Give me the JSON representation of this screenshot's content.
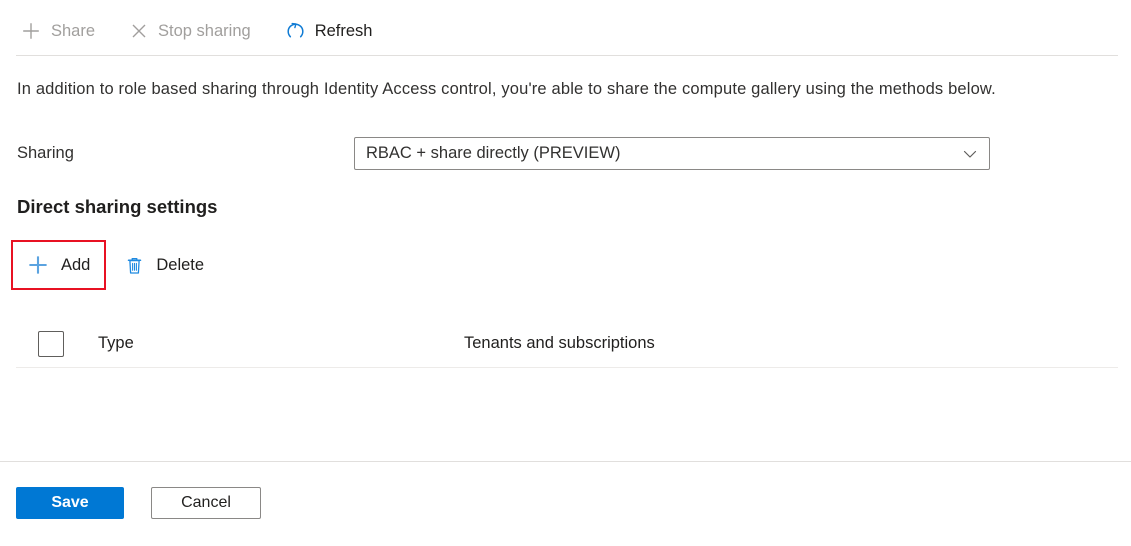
{
  "toolbar": {
    "items": [
      {
        "label": "Share",
        "icon": "plus-icon",
        "enabled": false
      },
      {
        "label": "Stop sharing",
        "icon": "close-x-icon",
        "enabled": false
      },
      {
        "label": "Refresh",
        "icon": "refresh-icon",
        "enabled": true
      }
    ]
  },
  "description": "In addition to role based sharing through Identity Access control, you're able to share the compute gallery using the methods below.",
  "sharing": {
    "label": "Sharing",
    "selected": "RBAC + share directly (PREVIEW)",
    "chevron": "chevron-down-icon"
  },
  "direct_sharing": {
    "heading": "Direct sharing settings",
    "commands": [
      {
        "label": "Add",
        "icon": "plus-icon",
        "highlighted": true
      },
      {
        "label": "Delete",
        "icon": "trash-icon",
        "highlighted": false
      }
    ],
    "table": {
      "select_all_checked": false,
      "columns": [
        "Type",
        "Tenants and subscriptions"
      ],
      "rows": []
    }
  },
  "footer": {
    "save_label": "Save",
    "cancel_label": "Cancel"
  },
  "colors": {
    "accent_blue": "#0078d4",
    "icon_blue": "#5ba3e0",
    "highlight_red": "#e81123",
    "disabled_gray": "#a19f9d",
    "text_primary": "#323130",
    "divider": "#e1dfdd"
  }
}
